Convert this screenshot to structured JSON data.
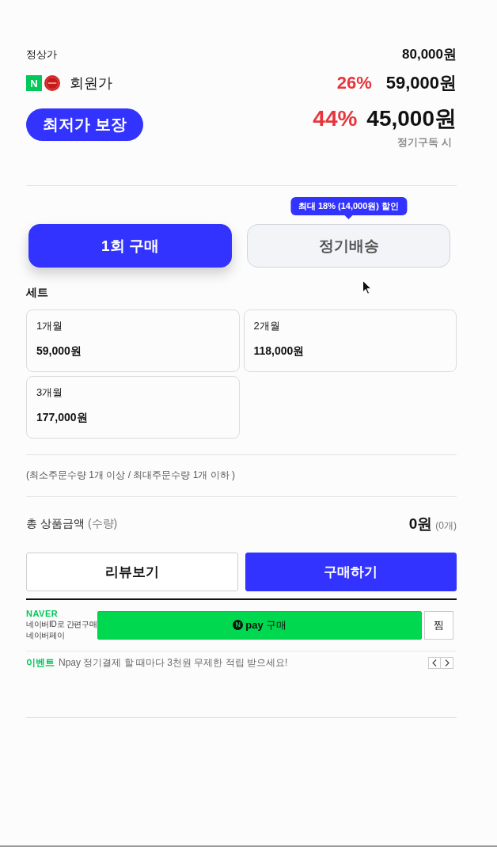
{
  "prices": {
    "regular": {
      "label": "정상가",
      "price": "80,000원"
    },
    "member": {
      "logos": [
        {
          "kind": "letter",
          "text": "N"
        },
        {
          "kind": "seal"
        }
      ],
      "label": "회원가",
      "discount": "26%",
      "price": "59,000원"
    },
    "lowest": {
      "badge": "최저가 보장",
      "discount": "44%",
      "price": "45,000원",
      "note": "정기구독 시"
    }
  },
  "purchase_tabs": [
    {
      "label": "1회 구매",
      "selected": true
    },
    {
      "label": "정기배송",
      "selected": false,
      "tooltip": "최대 18% (14,000원) 할인"
    }
  ],
  "option_group": {
    "title": "세트",
    "options": [
      {
        "name": "1개월",
        "price": "59,000원",
        "selected": false
      },
      {
        "name": "2개월",
        "price": "118,000원",
        "selected": false
      },
      {
        "name": "3개월",
        "price": "177,000원",
        "selected": false
      }
    ]
  },
  "quantity_note": "(최소주문수량 1개 이상 / 최대주문수량 1개 이하 )",
  "total": {
    "label": "총 상품금액",
    "sub_label": "(수량)",
    "amount": "0원",
    "count": "(0개)"
  },
  "buttons": [
    {
      "label": "리뷰보기",
      "kind": "outline"
    },
    {
      "label": "구매하기",
      "kind": "primary"
    }
  ],
  "naver_pay": {
    "brand": "NAVER",
    "lines": [
      "네이버ID로 간편구매",
      "네이버페이"
    ],
    "pay_button": {
      "logo": "N",
      "label": "**pay** 구매"
    },
    "wish_button": "찜",
    "event_tag": "이벤트",
    "event_text": "Npay 정기결제 할 때마다 3천원 무제한 적립 받으세요!"
  }
}
